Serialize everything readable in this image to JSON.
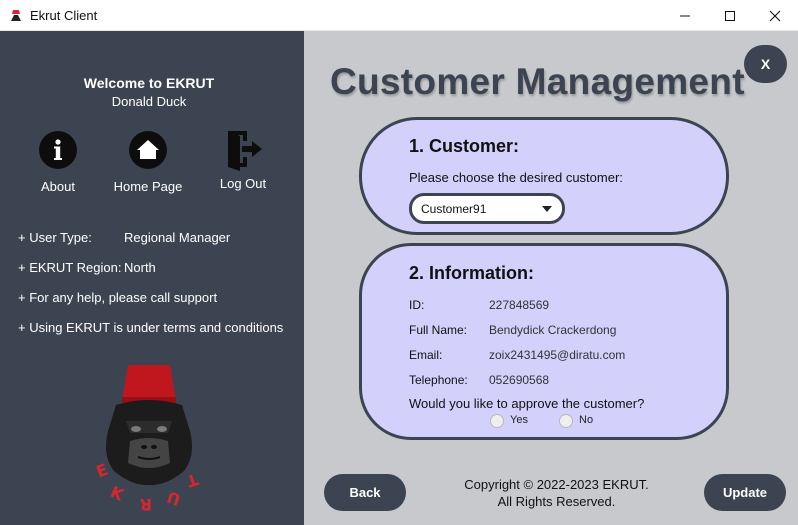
{
  "window": {
    "title": "Ekrut Client"
  },
  "sidebar": {
    "welcome": "Welcome to EKRUT",
    "username": "Donald Duck",
    "nav": [
      {
        "label": "About",
        "icon": "info-icon"
      },
      {
        "label": "Home Page",
        "icon": "home-icon"
      },
      {
        "label": "Log Out",
        "icon": "logout-icon"
      }
    ],
    "info": [
      {
        "label": "+ User Type:",
        "value": "Regional Manager"
      },
      {
        "label": "+ EKRUT Region:",
        "value": "North"
      },
      {
        "label": "+ For any help, please call support",
        "value": ""
      },
      {
        "label": "+ Using EKRUT is under terms and conditions",
        "value": ""
      }
    ]
  },
  "main": {
    "title": "Customer Management",
    "close_label": "X",
    "customer_section": {
      "title": "1. Customer:",
      "prompt": "Please choose the desired customer:",
      "selected": "Customer91"
    },
    "info_section": {
      "title": "2. Information:",
      "fields": [
        {
          "label": "ID:",
          "value": "227848569"
        },
        {
          "label": "Full Name:",
          "value": "Bendydick Crackerdong"
        },
        {
          "label": "Email:",
          "value": "zoix2431495@diratu.com"
        },
        {
          "label": "Telephone:",
          "value": "052690568"
        }
      ],
      "approve_question": "Would you like to approve the customer?",
      "yes_label": "Yes",
      "no_label": "No"
    },
    "back_label": "Back",
    "update_label": "Update",
    "copyright_line1": "Copyright © 2022-2023 EKRUT.",
    "copyright_line2": "All Rights Reserved."
  },
  "colors": {
    "sidebar_bg": "#3d4451",
    "main_bg": "#c7c9cc",
    "card_bg": "#d4d0fc",
    "logo_red": "#d7262e"
  }
}
